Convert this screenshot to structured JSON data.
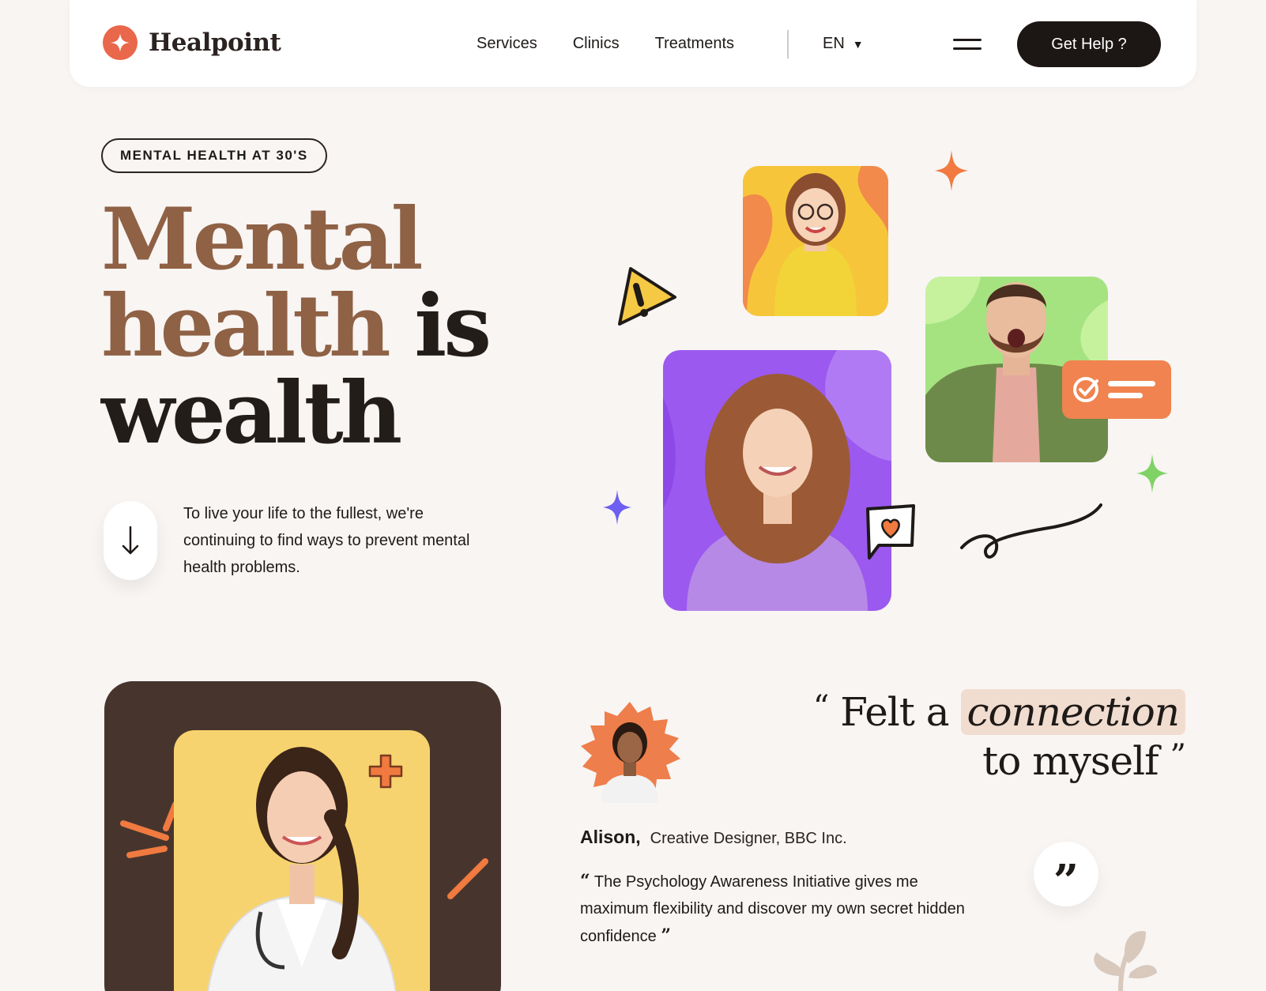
{
  "nav": {
    "brand": "Healpoint",
    "links": [
      "Services",
      "Clinics",
      "Treatments"
    ],
    "language": "EN",
    "cta_label": "Get Help ?"
  },
  "hero": {
    "badge": "MENTAL HEALTH AT 30'S",
    "headline_line1": "Mental",
    "headline_line2a": "health",
    "headline_line2b": "is",
    "headline_line3": "wealth",
    "subtitle": "To live your life to the fullest, we're continuing to find ways to prevent mental health problems."
  },
  "testimonial": {
    "quote_open": "“",
    "quote_part1": "Felt a",
    "quote_highlight": "connection",
    "quote_part2": "to myself",
    "quote_close": "”",
    "author_name": "Alison,",
    "author_role": "Creative Designer, BBC Inc.",
    "body_open": "“",
    "body": "The Psychology Awareness Initiative gives me maximum flexibility and discover my own secret hidden confidence",
    "body_close": "”",
    "bubble_mark": "”"
  },
  "colors": {
    "accent_orange": "#e9674a",
    "headline_brown": "#8f6145",
    "card_yellow": "#f7c53a",
    "card_green": "#a5e381",
    "card_purple": "#9b59f0",
    "dark_brown": "#47352d",
    "button_dark": "#1c1614"
  },
  "icons": [
    "star-logo-icon",
    "chevron-down-icon",
    "menu-icon",
    "arrow-down-icon",
    "warning-icon",
    "sparkle-icon",
    "heart-chat-icon",
    "check-card-icon",
    "plus-icon",
    "leaf-icon",
    "quote-icon"
  ]
}
